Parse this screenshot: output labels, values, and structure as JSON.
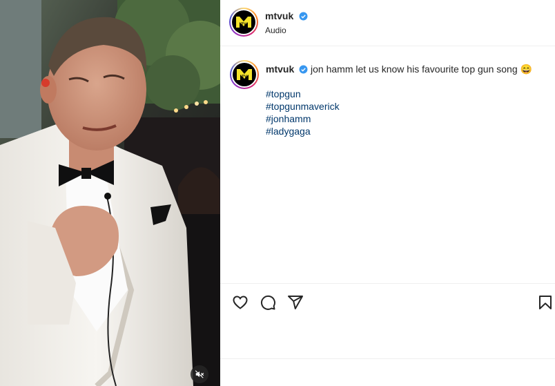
{
  "post": {
    "username": "mtvuk",
    "subtitle": "Audio",
    "verified": true,
    "caption": "jon hamm let us know his favourite top gun song 😄",
    "hashtags": [
      "#topgun",
      "#topgunmaverick",
      "#jonhamm",
      "#ladygaga"
    ]
  },
  "brand": {
    "logo_text": "M",
    "logo_subtext": "TV",
    "logo_color": "#f5e32b",
    "verified_color": "#3797f0",
    "hashtag_color": "#00376b"
  },
  "icons": {
    "like": "heart-icon",
    "comment": "comment-icon",
    "share": "share-icon",
    "save": "bookmark-icon",
    "mute": "muted-speaker-icon",
    "verified": "verified-badge-icon"
  }
}
